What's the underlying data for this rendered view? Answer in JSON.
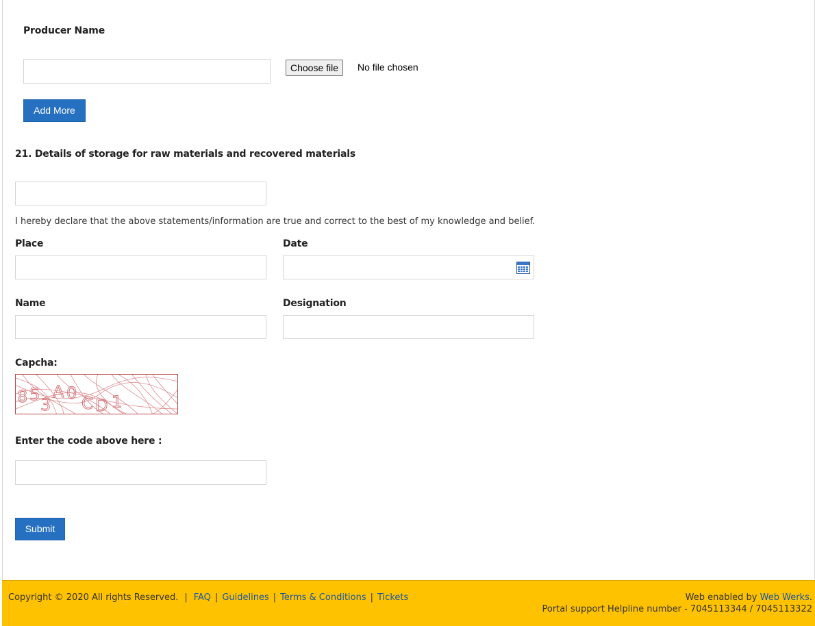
{
  "producer": {
    "label": "Producer Name",
    "name_value": "",
    "file_button_label": "Choose file",
    "file_status": "No file chosen",
    "add_more_label": "Add More"
  },
  "storage": {
    "label": "21. Details of storage for raw materials and recovered materials",
    "value": ""
  },
  "declaration": "I hereby declare that the above statements/information are true and correct to the best of my knowledge and belief.",
  "place": {
    "label": "Place",
    "value": ""
  },
  "date": {
    "label": "Date",
    "value": "",
    "icon": "calendar-icon"
  },
  "name": {
    "label": "Name",
    "value": ""
  },
  "designation": {
    "label": "Designation",
    "value": ""
  },
  "captcha": {
    "label": "Capcha:",
    "code_chars": [
      "8",
      "5",
      "3",
      "A",
      "0",
      "C",
      "D",
      "1"
    ],
    "input_label": "Enter the code above here :",
    "input_value": ""
  },
  "submit_label": "Submit",
  "footer": {
    "copyright": "Copyright © 2020 All rights Reserved.",
    "links": [
      "FAQ",
      "Guidelines",
      "Terms & Conditions",
      "Tickets"
    ],
    "enabled_by_prefix": "Web enabled by ",
    "enabled_by_link": "Web Werks",
    "enabled_by_suffix": ".",
    "helpline": "Portal support Helpline number - 7045113344 / 7045113322"
  },
  "colors": {
    "primary_button": "#2670c2",
    "footer_background": "#ffc200",
    "link": "#1a57a5",
    "captcha_lines": "#d9868a"
  }
}
